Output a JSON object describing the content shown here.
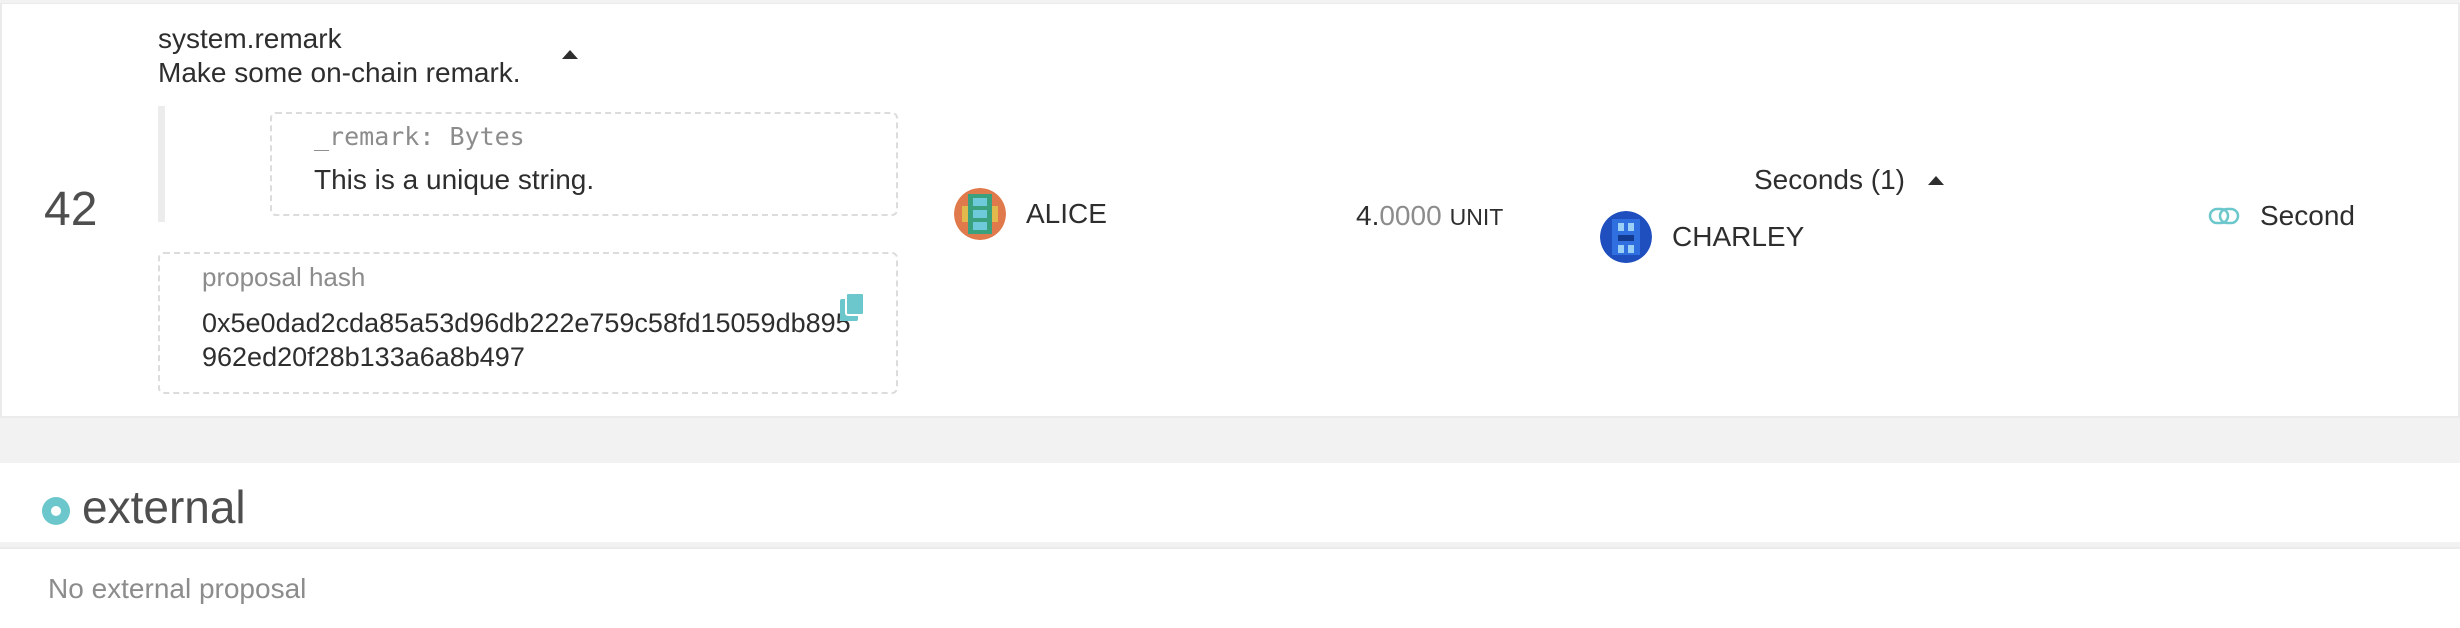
{
  "proposal": {
    "index": "42",
    "call_name": "system.remark",
    "call_description": "Make some on-chain remark.",
    "param_label": "_remark: Bytes",
    "param_value": "This is a unique string.",
    "hash_label": "proposal hash",
    "hash_value": "0x5e0dad2cda85a53d96db222e759c58fd15059db895962ed20f28b133a6a8b497",
    "proposer": "ALICE",
    "balance_whole": "4.",
    "balance_decimals": "0000",
    "balance_unit": "UNIT",
    "seconds_label": "Seconds (1)",
    "seconder": "CHARLEY",
    "second_button_label": "Second"
  },
  "external": {
    "title": "external",
    "empty_text": "No external proposal"
  },
  "colors": {
    "accent": "#6bc7cc",
    "text": "#2e2e2e",
    "muted": "#8c8c8c",
    "background": "#f2f2f2"
  },
  "icons": {
    "copy": "copy-icon",
    "second": "toggle-link-icon",
    "section": "dot-circle-icon"
  }
}
